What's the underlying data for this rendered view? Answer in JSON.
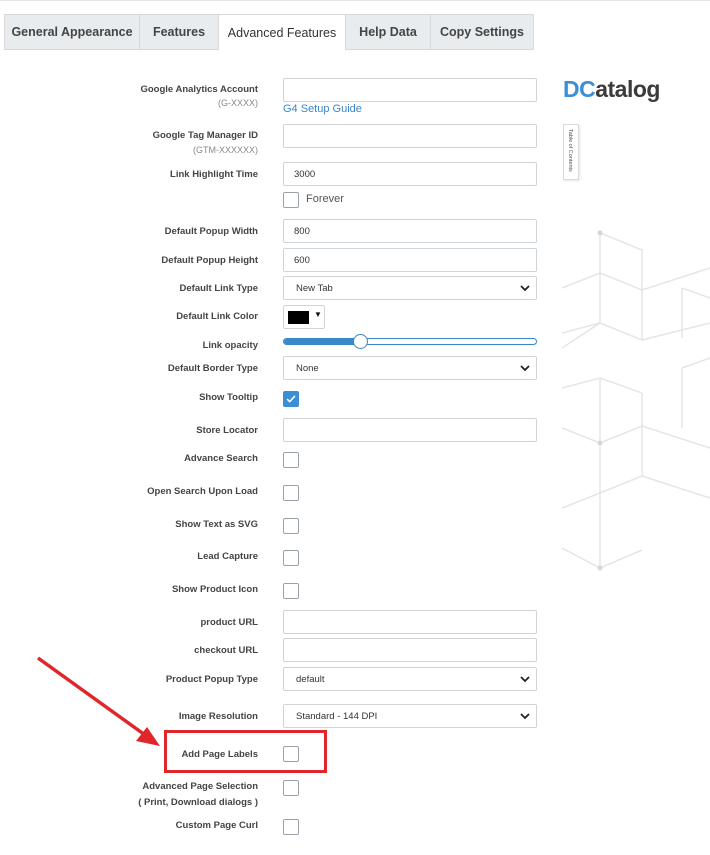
{
  "tabs": [
    {
      "label": "General Appearance",
      "active": false
    },
    {
      "label": "Features",
      "active": false
    },
    {
      "label": "Advanced Features",
      "active": true
    },
    {
      "label": "Help Data",
      "active": false
    },
    {
      "label": "Copy Settings",
      "active": false
    }
  ],
  "brand": {
    "logo_prefix": "DC",
    "logo_suffix": "atalog",
    "toc_label": "Table of Contents"
  },
  "form": {
    "ga_label": "Google Analytics Account",
    "ga_hint": "(G-XXXX)",
    "ga_value": "",
    "ga_link": "G4 Setup Guide",
    "gtm_label": "Google Tag Manager ID",
    "gtm_hint": "(GTM-XXXXXX)",
    "gtm_value": "",
    "highlight_time_label": "Link Highlight Time",
    "highlight_time_value": "3000",
    "forever_label": "Forever",
    "popup_width_label": "Default Popup Width",
    "popup_width_value": "800",
    "popup_height_label": "Default Popup Height",
    "popup_height_value": "600",
    "link_type_label": "Default Link Type",
    "link_type_value": "New Tab",
    "link_color_label": "Default Link Color",
    "link_color_value": "#000000",
    "link_opacity_label": "Link opacity",
    "link_opacity_fraction": 0.3,
    "border_type_label": "Default Border Type",
    "border_type_value": "None",
    "show_tooltip_label": "Show Tooltip",
    "show_tooltip_checked": true,
    "store_locator_label": "Store Locator",
    "store_locator_value": "",
    "advance_search_label": "Advance Search",
    "open_search_label": "Open Search Upon Load",
    "show_svg_label": "Show Text as SVG",
    "lead_capture_label": "Lead Capture",
    "product_icon_label": "Show Product Icon",
    "product_url_label": "product URL",
    "product_url_value": "",
    "checkout_url_label": "checkout URL",
    "checkout_url_value": "",
    "popup_type_label": "Product Popup Type",
    "popup_type_value": "default",
    "image_res_label": "Image Resolution",
    "image_res_value": "Standard - 144 DPI",
    "page_labels_label": "Add Page Labels",
    "adv_page_sel_label": "Advanced Page Selection",
    "adv_page_sel_hint": "( Print, Download dialogs )",
    "page_curl_label": "Custom Page Curl"
  },
  "colors": {
    "accent": "#3a8fd6",
    "highlight": "#e0262a",
    "link": "#3a87c9"
  }
}
